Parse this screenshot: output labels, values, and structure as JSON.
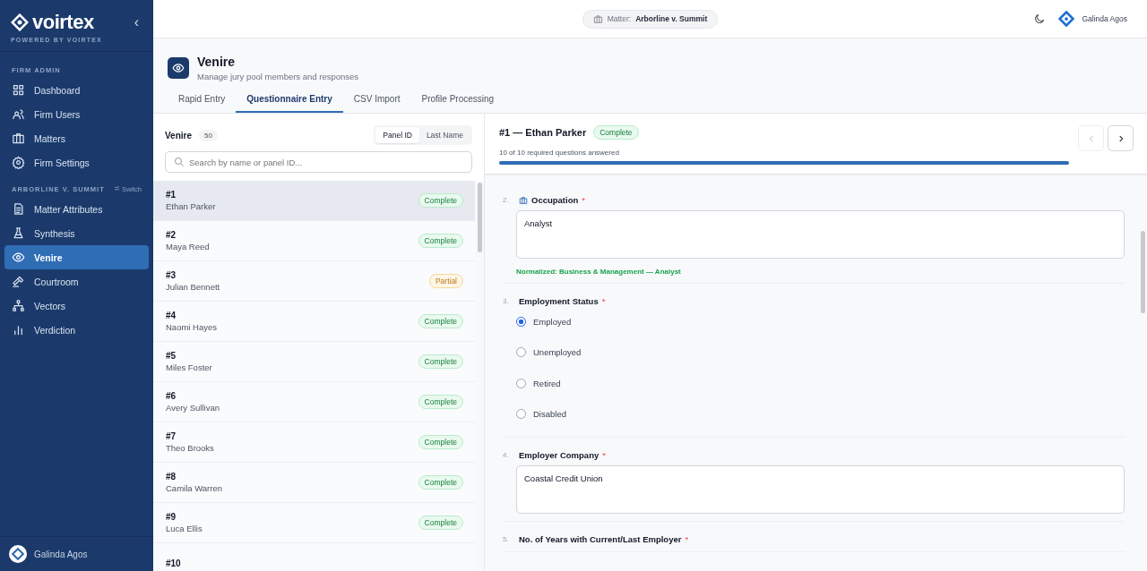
{
  "sidebar": {
    "brand": "voirtex",
    "tagline": "POWERED BY VOIRTEX",
    "collapse": "‹",
    "sections": [
      {
        "title": "FIRM ADMIN",
        "items": [
          {
            "label": "Dashboard",
            "selected": false
          },
          {
            "label": "Firm Users",
            "selected": false
          },
          {
            "label": "Matters",
            "selected": false
          },
          {
            "label": "Firm Settings",
            "selected": false
          }
        ]
      },
      {
        "title": "ARBORLINE V. SUMMIT",
        "action": "Switch",
        "items": [
          {
            "label": "Matter Attributes",
            "selected": false
          },
          {
            "label": "Synthesis",
            "selected": false
          },
          {
            "label": "Venire",
            "selected": true
          },
          {
            "label": "Courtroom",
            "selected": false
          },
          {
            "label": "Vectors",
            "selected": false
          },
          {
            "label": "Verdiction",
            "selected": false
          }
        ]
      }
    ],
    "user": "Galinda Agos"
  },
  "topbar": {
    "matter_label": "Matter:",
    "matter": "Arborline v. Summit",
    "user": "Galinda Agos"
  },
  "page": {
    "title": "Venire",
    "subtitle": "Manage jury pool members and responses"
  },
  "tabs": [
    {
      "label": "Rapid Entry",
      "selected": false
    },
    {
      "label": "Questionnaire Entry",
      "selected": true
    },
    {
      "label": "CSV Import",
      "selected": false
    },
    {
      "label": "Profile Processing",
      "selected": false
    }
  ],
  "list": {
    "title": "Venire",
    "count": "50",
    "sort": [
      {
        "label": "Panel ID",
        "selected": true
      },
      {
        "label": "Last Name",
        "selected": false
      }
    ],
    "search": {
      "placeholder": "Search by name or panel ID..."
    },
    "rows": [
      {
        "id": "#1",
        "name": "Ethan Parker",
        "status": "Complete",
        "kind": "complete",
        "selected": true
      },
      {
        "id": "#2",
        "name": "Maya Reed",
        "status": "Complete",
        "kind": "complete",
        "selected": false
      },
      {
        "id": "#3",
        "name": "Julian Bennett",
        "status": "Partial",
        "kind": "partial",
        "selected": false
      },
      {
        "id": "#4",
        "name": "Naomi Hayes",
        "status": "Complete",
        "kind": "complete",
        "selected": false
      },
      {
        "id": "#5",
        "name": "Miles Foster",
        "status": "Complete",
        "kind": "complete",
        "selected": false
      },
      {
        "id": "#6",
        "name": "Avery Sullivan",
        "status": "Complete",
        "kind": "complete",
        "selected": false
      },
      {
        "id": "#7",
        "name": "Theo Brooks",
        "status": "Complete",
        "kind": "complete",
        "selected": false
      },
      {
        "id": "#8",
        "name": "Camila Warren",
        "status": "Complete",
        "kind": "complete",
        "selected": false
      },
      {
        "id": "#9",
        "name": "Luca Ellis",
        "status": "Complete",
        "kind": "complete",
        "selected": false
      },
      {
        "id": "#10",
        "selected": false
      }
    ]
  },
  "detail": {
    "title": "#1 — Ethan Parker",
    "status": "Complete",
    "progress_text": "10 of 10 required questions answered",
    "level": 1.0,
    "prev_disabled": true,
    "next_disabled": false,
    "questions": [
      {
        "number": "2.",
        "label": "Occupation",
        "required": "*",
        "kind": "text",
        "value": "Analyst",
        "note": "Normalized: Business & Management — Analyst",
        "icon": true
      },
      {
        "number": "3.",
        "label": "Employment Status",
        "required": "*",
        "kind": "radio",
        "options": [
          {
            "label": "Employed",
            "selected": true
          },
          {
            "label": "Unemployed",
            "selected": false
          },
          {
            "label": "Retired",
            "selected": false
          },
          {
            "label": "Disabled",
            "selected": false
          }
        ]
      },
      {
        "number": "4.",
        "label": "Employer Company",
        "required": "*",
        "kind": "text",
        "value": "Coastal Credit Union"
      },
      {
        "number": "5.",
        "label": "No. of Years with Current/Last Employer",
        "required": "*",
        "kind": "heading"
      }
    ]
  }
}
